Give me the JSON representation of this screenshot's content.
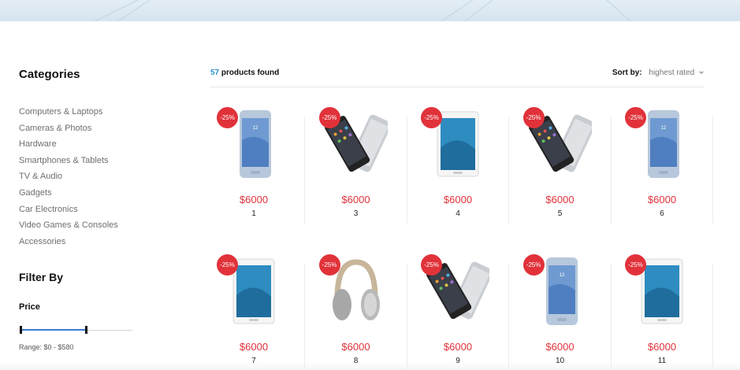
{
  "sidebar": {
    "categories_title": "Categories",
    "categories": [
      "Computers & Laptops",
      "Cameras & Photos",
      "Hardware",
      "Smartphones & Tablets",
      "TV & Audio",
      "Gadgets",
      "Car Electronics",
      "Video Games & Consoles",
      "Accessories"
    ],
    "filter_title": "Filter By",
    "price_label": "Price",
    "price_range_text": "Range: $0 - $580",
    "price_min": 0,
    "price_max": 580
  },
  "results": {
    "count": "57",
    "count_suffix": " products found",
    "sort_label": "Sort by:",
    "sort_value": "highest rated"
  },
  "colors": {
    "accent": "#2e8fce",
    "sale": "#e1323a"
  },
  "products": [
    {
      "name": "1",
      "price": "$6000",
      "badge": "-25%",
      "image": "phone-front-blue"
    },
    {
      "name": "3",
      "price": "$6000",
      "badge": "-25%",
      "image": "phone-tilted-pair"
    },
    {
      "name": "4",
      "price": "$6000",
      "badge": "-25%",
      "image": "tablet-white"
    },
    {
      "name": "5",
      "price": "$6000",
      "badge": "-25%",
      "image": "phone-tilted-pair"
    },
    {
      "name": "6",
      "price": "$6000",
      "badge": "-25%",
      "image": "phone-front-blue"
    },
    {
      "name": "7",
      "price": "$6000",
      "badge": "-25%",
      "image": "tablet-white"
    },
    {
      "name": "8",
      "price": "$6000",
      "badge": "-25%",
      "image": "headphones"
    },
    {
      "name": "9",
      "price": "$6000",
      "badge": "-25%",
      "image": "phone-tilted-pair"
    },
    {
      "name": "10",
      "price": "$6000",
      "badge": "-25%",
      "image": "phone-front-blue"
    },
    {
      "name": "11",
      "price": "$6000",
      "badge": "-25%",
      "image": "tablet-white"
    }
  ]
}
